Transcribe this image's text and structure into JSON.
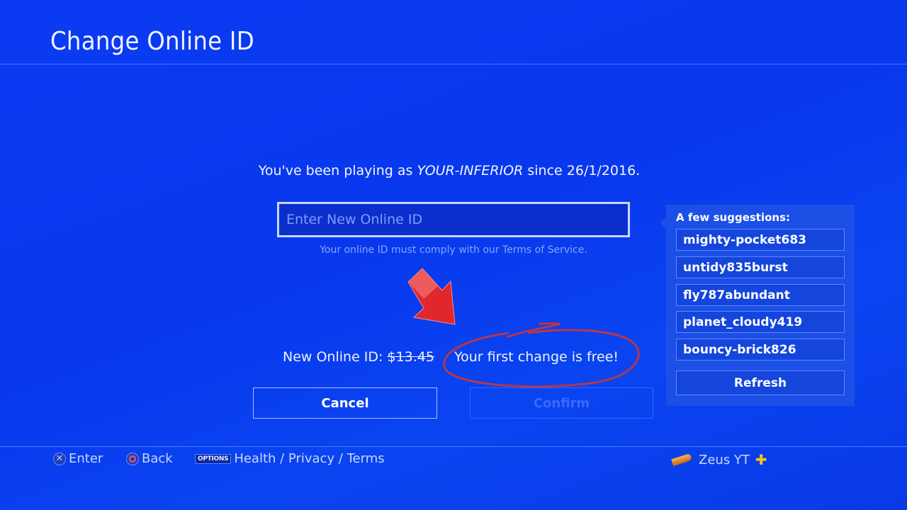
{
  "header": {
    "title": "Change Online ID"
  },
  "main": {
    "intro_prefix": "You've been playing as ",
    "current_id": "YOUR-INFERIOR",
    "intro_suffix": " since 26/1/2016.",
    "input": {
      "placeholder": "Enter New Online ID",
      "value": ""
    },
    "tos_note": "Your online ID must comply with our Terms of Service.",
    "price_label": "New Online ID: ",
    "price_old": "$13.45",
    "free_note": "Your first change is free!",
    "buttons": {
      "cancel": "Cancel",
      "confirm": "Confirm"
    }
  },
  "suggestions": {
    "title": "A few suggestions:",
    "items": [
      "mighty-pocket683",
      "untidy835burst",
      "fly787abundant",
      "planet_cloudy419",
      "bouncy-brick826"
    ],
    "refresh": "Refresh"
  },
  "footer": {
    "hints": [
      {
        "icon": "cross-button-icon",
        "label": "Enter"
      },
      {
        "icon": "circle-button-icon",
        "label": "Back"
      },
      {
        "icon": "options-button-icon",
        "badge": "OPTIONS",
        "label": "Health / Privacy / Terms"
      }
    ],
    "user": {
      "avatar_icon": "bullet-avatar-icon",
      "name": "Zeus YT",
      "badge_icon": "ps-plus-icon"
    }
  },
  "annotations": {
    "arrow_color": "#e0272b",
    "circle_color": "#c8363c"
  }
}
